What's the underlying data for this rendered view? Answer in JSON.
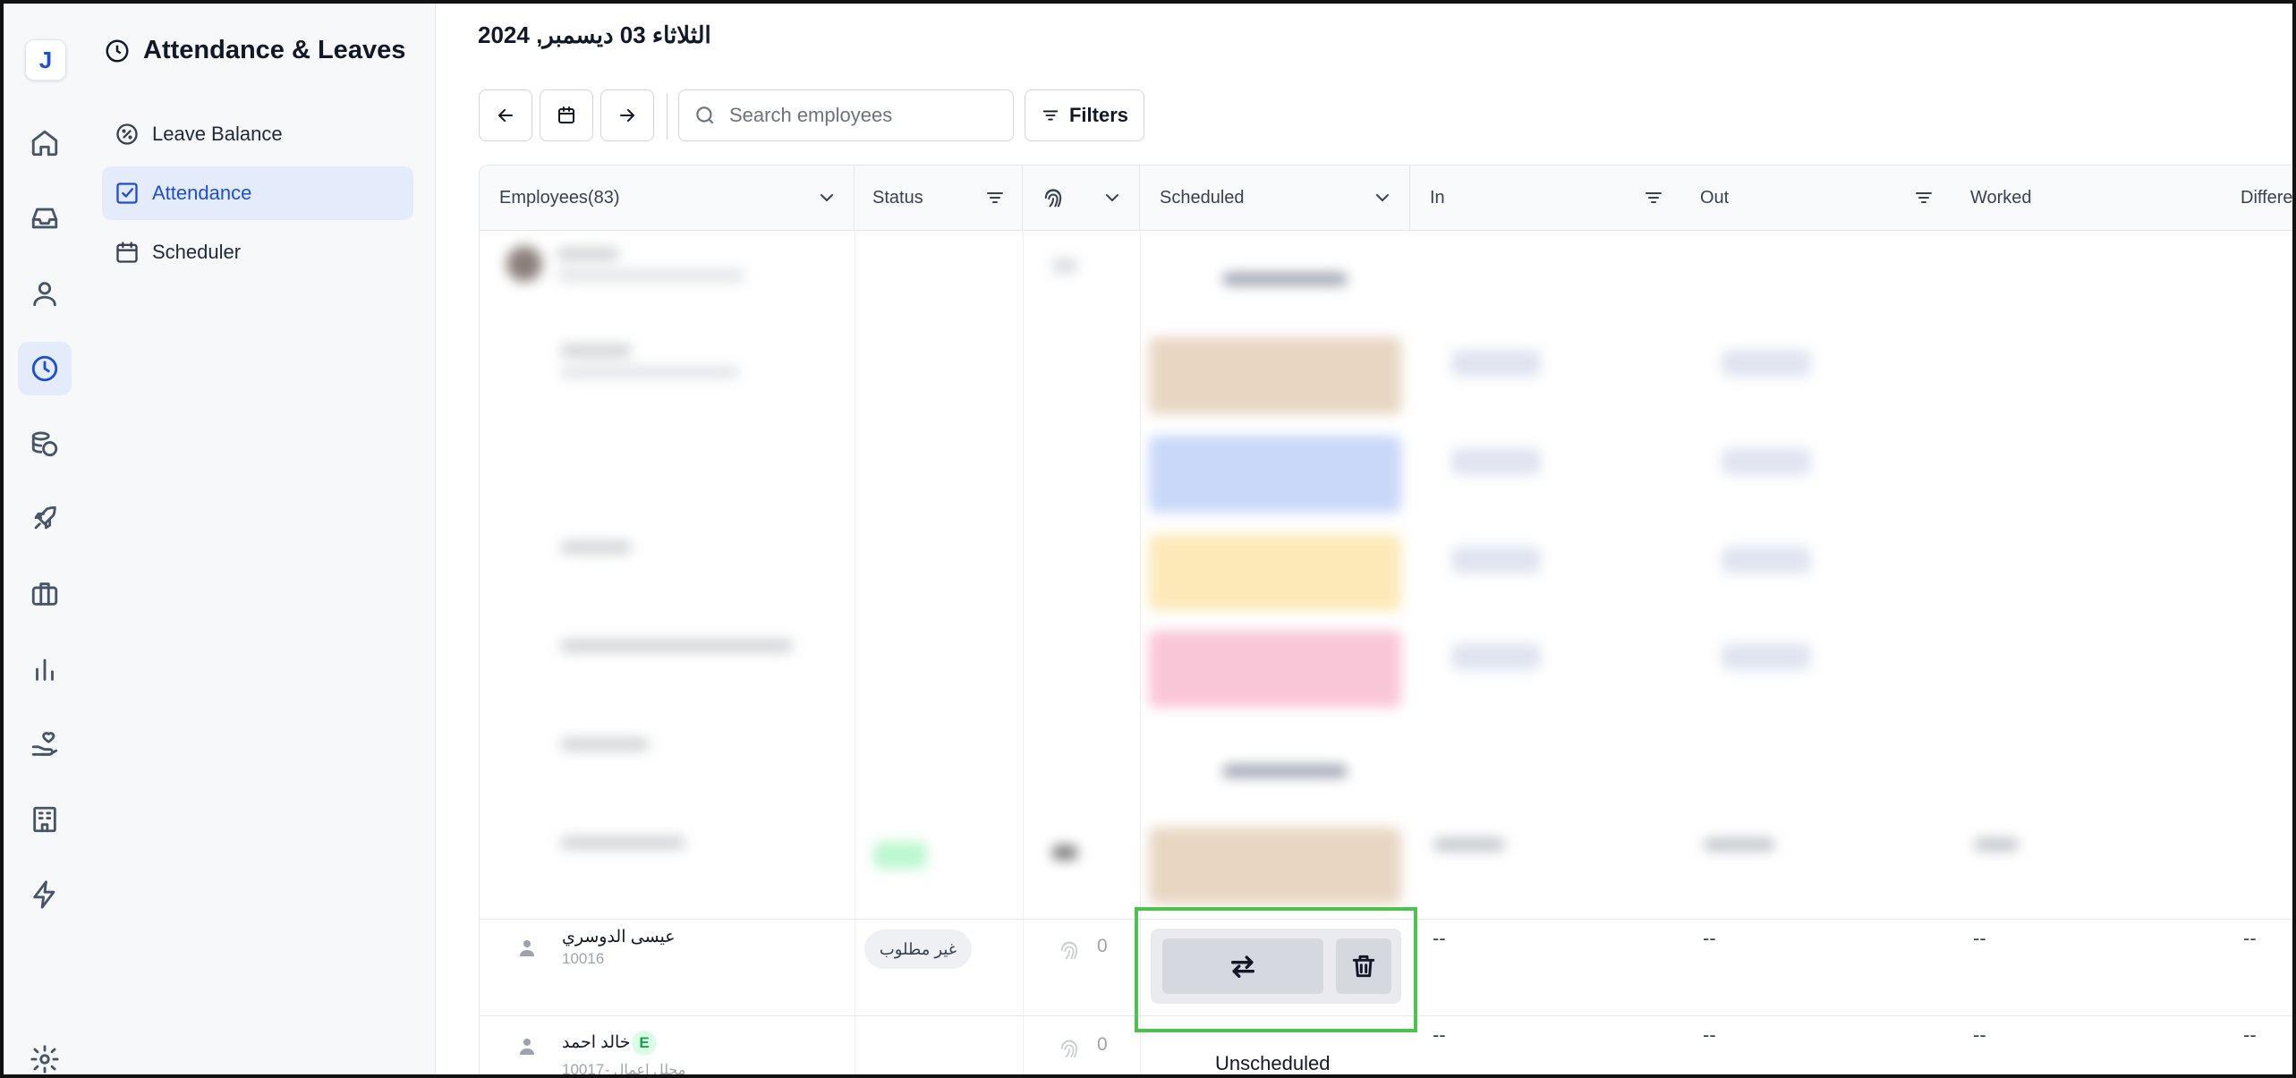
{
  "app": {
    "logo_letter": "J",
    "accent": "#1d4ed8",
    "highlight_color": "#4cc34a"
  },
  "rail": [
    {
      "icon": "home-icon"
    },
    {
      "icon": "inbox-icon"
    },
    {
      "icon": "user-icon"
    },
    {
      "icon": "clock-icon",
      "active": true
    },
    {
      "icon": "coins-icon"
    },
    {
      "icon": "rocket-icon"
    },
    {
      "icon": "briefcase-icon"
    },
    {
      "icon": "bar-chart-icon"
    },
    {
      "icon": "hand-heart-icon"
    },
    {
      "icon": "building-icon"
    },
    {
      "icon": "lightning-icon"
    },
    {
      "icon": "gear-icon"
    }
  ],
  "sidebar": {
    "title": "Attendance & Leaves",
    "items": [
      {
        "label": "Leave Balance",
        "icon": "percent-badge-icon"
      },
      {
        "label": "Attendance",
        "icon": "checkbox-icon",
        "active": true
      },
      {
        "label": "Scheduler",
        "icon": "calendar-icon"
      }
    ]
  },
  "header": {
    "date": "الثلاثاء 03 ديسمبر, 2024"
  },
  "toolbar": {
    "search_placeholder": "Search employees",
    "filters_label": "Filters"
  },
  "table": {
    "columns": [
      "Employees(83)",
      "Status",
      "",
      "Scheduled",
      "In",
      "Out",
      "Worked",
      "Differe"
    ],
    "rows": [
      {
        "name": "عيسى الدوسري",
        "id": "10016",
        "status": "غير مطلوب",
        "punches": "0",
        "in": "--",
        "out": "--",
        "worked": "--",
        "difference": "--"
      },
      {
        "name": "خالد احمد",
        "badge": "E",
        "id": "10017",
        "subtitle": "محلل اعمال -",
        "punches": "0",
        "scheduled": "Unscheduled",
        "in": "--",
        "out": "--",
        "worked": "--",
        "difference": "--"
      }
    ]
  }
}
